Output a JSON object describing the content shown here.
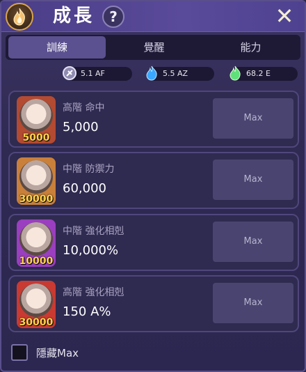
{
  "header": {
    "title": "成長",
    "help_label": "?",
    "close_label": "✕"
  },
  "tabs": [
    {
      "label": "訓練",
      "active": true
    },
    {
      "label": "覺醒",
      "active": false
    },
    {
      "label": "能力",
      "active": false
    }
  ],
  "currencies": [
    {
      "icon": "gear-coin-icon",
      "value": "5.1 AF"
    },
    {
      "icon": "blue-flame-icon",
      "value": "5.5 AZ"
    },
    {
      "icon": "green-flame-icon",
      "value": "68.2 E"
    }
  ],
  "upgrades": [
    {
      "name": "高階 命中",
      "value": "5,000",
      "cost": "5000",
      "button": "Max",
      "portrait_color": "#e9e0da",
      "frame_color": "#b34a32"
    },
    {
      "name": "中階 防禦力",
      "value": "60,000",
      "cost": "30000",
      "button": "Max",
      "portrait_color": "#e8c9b6",
      "frame_color": "#c9803a"
    },
    {
      "name": "中階 強化相剋",
      "value": "10,000%",
      "cost": "10000",
      "button": "Max",
      "portrait_color": "#e6c7e0",
      "frame_color": "#9a3fbf"
    },
    {
      "name": "高階 強化相剋",
      "value": "150 A%",
      "cost": "30000",
      "button": "Max",
      "portrait_color": "#f0cdb8",
      "frame_color": "#c93a32"
    }
  ],
  "footer": {
    "hide_max_label": "隱藏Max",
    "hide_max_checked": false
  },
  "colors": {
    "accent": "#5b5190",
    "gold": "#ffd44a",
    "panel": "#2f2a50"
  }
}
